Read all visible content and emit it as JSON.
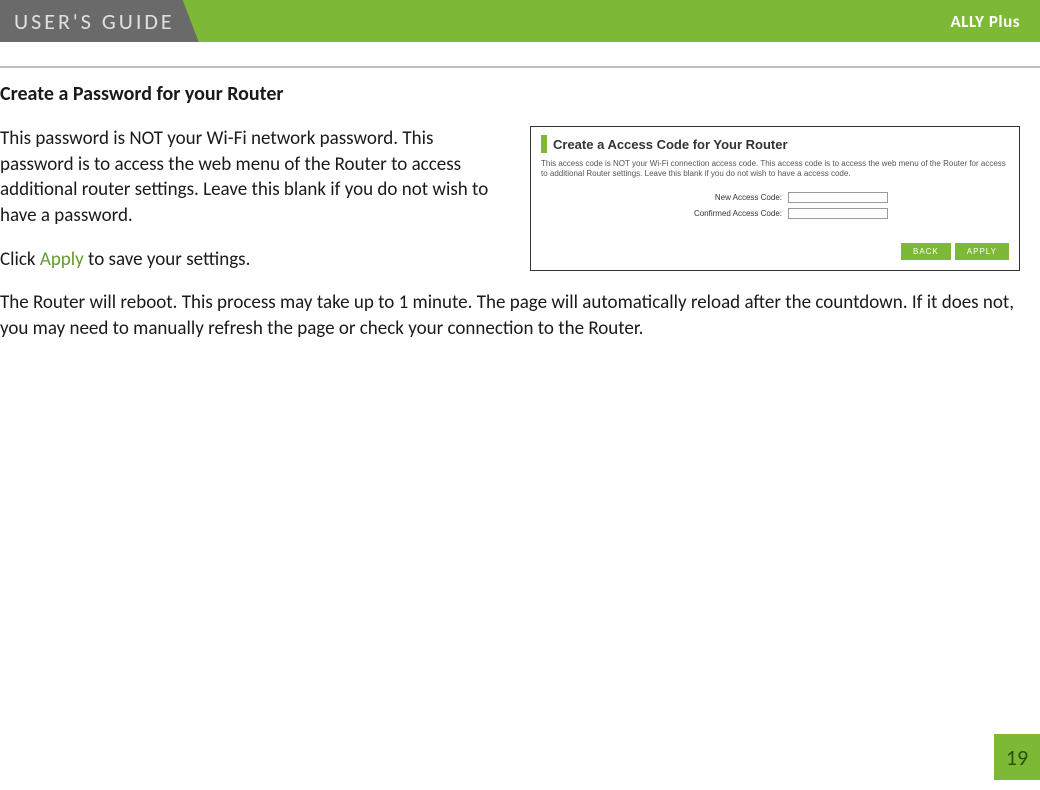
{
  "header": {
    "guide_label": "USER'S GUIDE",
    "product": "ALLY Plus"
  },
  "main": {
    "heading": "Create a Password for your Router",
    "para1": "This password is NOT your Wi-Fi network password. This password is to access the web menu of the Router to access additional router settings. Leave this blank if you do not wish to have a password.",
    "para2_prefix": "Click ",
    "para2_apply": "Apply",
    "para2_suffix": " to save your settings.",
    "para3": "The Router will reboot. This process may take up to 1 minute. The page will automatically reload after the countdown. If it does not, you may need to manually refresh the page or check your connection to the Router."
  },
  "figure": {
    "title": "Create a Access Code for Your Router",
    "description": "This access code is NOT your Wi-Fi connection access code. This access code is to access the web menu of the Router for access to additional Router settings. Leave this blank if you do not wish to have a access code.",
    "field1_label": "New Access Code:",
    "field2_label": "Confirmed Access Code:",
    "back_label": "BACK",
    "apply_label": "APPLY"
  },
  "page_number": "19"
}
